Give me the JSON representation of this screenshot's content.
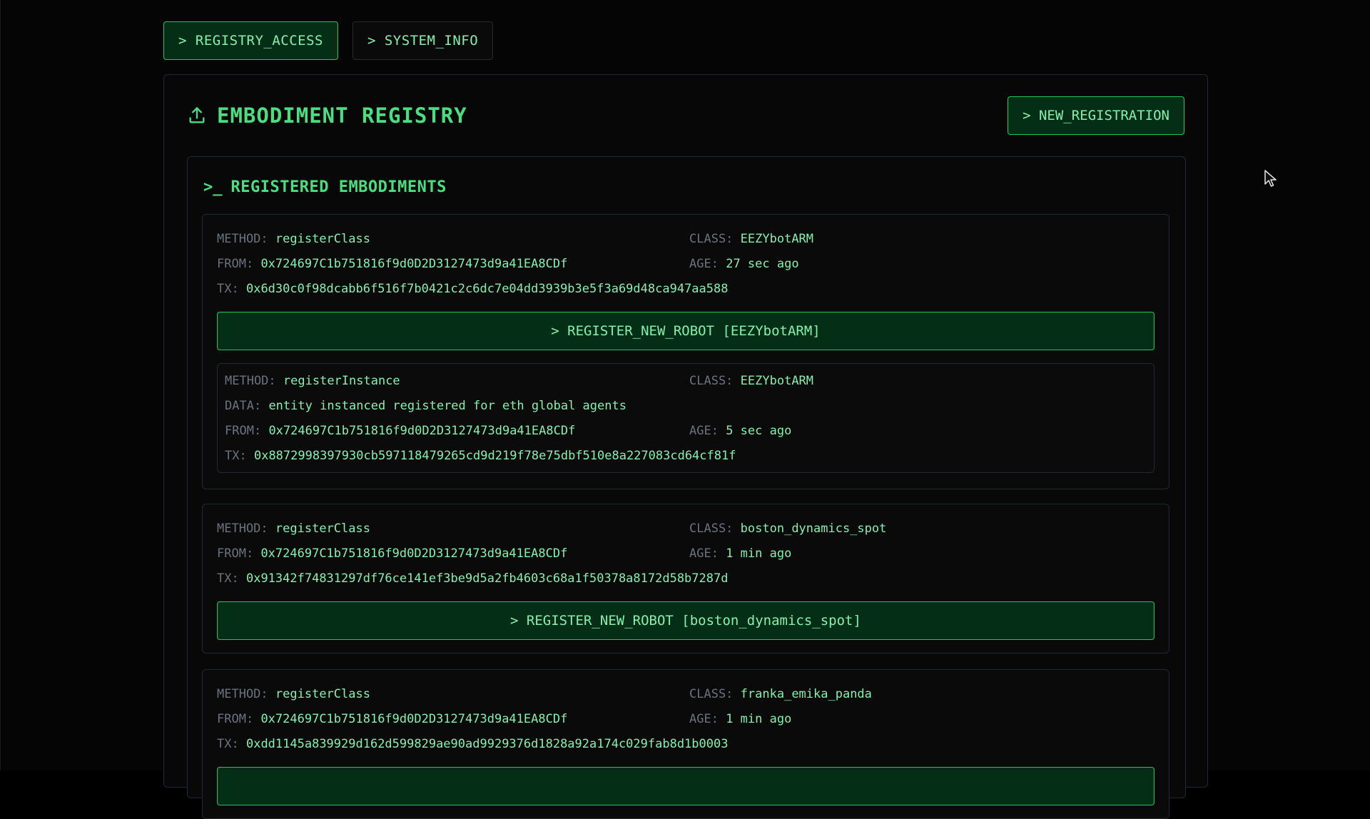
{
  "tabs": [
    {
      "label": "> REGISTRY_ACCESS",
      "active": true
    },
    {
      "label": "> SYSTEM_INFO",
      "active": false
    }
  ],
  "header": {
    "title": "EMBODIMENT REGISTRY",
    "title_icon": "upload-icon",
    "new_button": "> NEW_REGISTRATION"
  },
  "list": {
    "title_prompt": ">_",
    "title": "REGISTERED EMBODIMENTS"
  },
  "labels": {
    "method": "METHOD:",
    "class": "CLASS:",
    "from": "FROM:",
    "age": "AGE:",
    "tx": "TX:",
    "data": "DATA:"
  },
  "entries": [
    {
      "method": "registerClass",
      "class": "EEZYbotARM",
      "from": "0x724697C1b751816f9d0D2D3127473d9a41EA8CDf",
      "age": "27 sec ago",
      "tx": "0x6d30c0f98dcabb6f516f7b0421c2c6dc7e04dd3939b3e5f3a69d48ca947aa588",
      "button": "> REGISTER_NEW_ROBOT [EEZYbotARM]",
      "instance": {
        "method": "registerInstance",
        "class": "EEZYbotARM",
        "data": "entity instanced registered for eth global agents",
        "from": "0x724697C1b751816f9d0D2D3127473d9a41EA8CDf",
        "age": "5 sec ago",
        "tx": "0x8872998397930cb597118479265cd9d219f78e75dbf510e8a227083cd64cf81f"
      }
    },
    {
      "method": "registerClass",
      "class": "boston_dynamics_spot",
      "from": "0x724697C1b751816f9d0D2D3127473d9a41EA8CDf",
      "age": "1 min ago",
      "tx": "0x91342f74831297df76ce141ef3be9d5a2fb4603c68a1f50378a8172d58b7287d",
      "button": "> REGISTER_NEW_ROBOT [boston_dynamics_spot]"
    },
    {
      "method": "registerClass",
      "class": "franka_emika_panda",
      "from": "0x724697C1b751816f9d0D2D3127473d9a41EA8CDf",
      "age": "1 min ago",
      "tx": "0xdd1145a839929d162d599829ae90ad9929376d1828a92a174c029fab8d1b0003"
    }
  ],
  "colors": {
    "accent": "#4ade80",
    "accent_border": "#22c55e",
    "button_bg": "#052e16",
    "label": "#6b7280",
    "background": "#050505"
  }
}
